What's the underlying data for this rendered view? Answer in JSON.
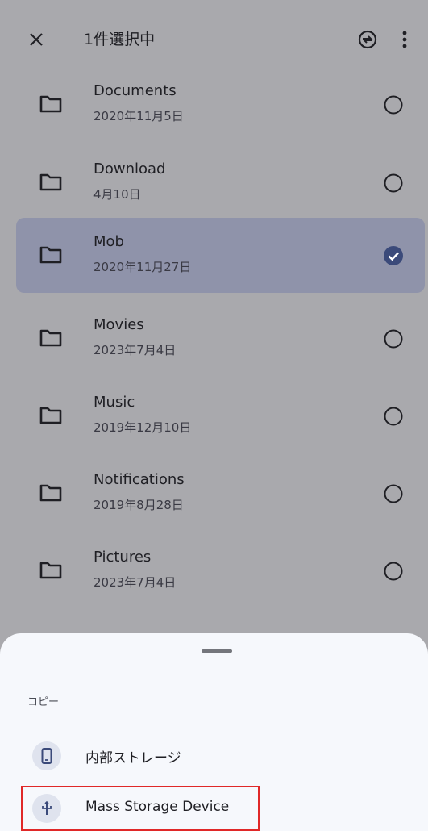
{
  "header": {
    "title": "1件選択中",
    "close_icon": "close-icon",
    "sync_icon": "sync-icon",
    "more_icon": "more-vert-icon"
  },
  "folders": [
    {
      "name": "Documents",
      "date": "2020年11月5日",
      "selected": false
    },
    {
      "name": "Download",
      "date": "4月10日",
      "selected": false
    },
    {
      "name": "Mob",
      "date": "2020年11月27日",
      "selected": true
    },
    {
      "name": "Movies",
      "date": "2023年7月4日",
      "selected": false
    },
    {
      "name": "Music",
      "date": "2019年12月10日",
      "selected": false
    },
    {
      "name": "Notifications",
      "date": "2019年8月28日",
      "selected": false
    },
    {
      "name": "Pictures",
      "date": "2023年7月4日",
      "selected": false
    }
  ],
  "sheet": {
    "section_label": "コピー",
    "options": [
      {
        "label": "内部ストレージ",
        "icon": "phone-icon"
      },
      {
        "label": "Mass Storage Device",
        "icon": "usb-icon"
      }
    ]
  },
  "colors": {
    "dim_background": "#a9a9ad",
    "selected_row": "#8f93aa",
    "check_fill": "#3b4a7a",
    "sheet_bg": "#f6f8fc",
    "highlight_border": "#e02828"
  }
}
